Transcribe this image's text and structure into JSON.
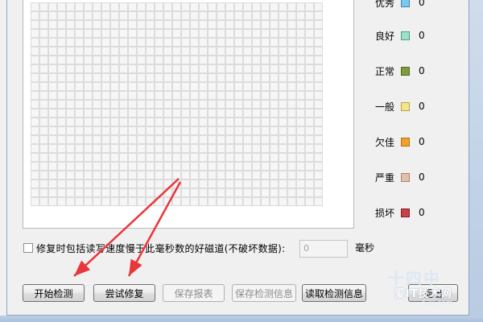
{
  "legend": {
    "items": [
      {
        "label": "优秀",
        "count": "0",
        "color": "#7cc8ee",
        "border": "#3c86b6"
      },
      {
        "label": "良好",
        "count": "0",
        "color": "#9ddfc8",
        "border": "#4d9e86"
      },
      {
        "label": "正常",
        "count": "0",
        "color": "#7e9b3e",
        "border": "#4d6a20"
      },
      {
        "label": "一般",
        "count": "0",
        "color": "#f5e58a",
        "border": "#b8a34a"
      },
      {
        "label": "欠佳",
        "count": "0",
        "color": "#f0a030",
        "border": "#b86e10"
      },
      {
        "label": "严重",
        "count": "0",
        "color": "#e2c0ac",
        "border": "#a8846e"
      },
      {
        "label": "损坏",
        "count": "0",
        "color": "#c8404a",
        "border": "#8a1e26"
      }
    ]
  },
  "options": {
    "repair_slow_label": "修复时包括读写速度慢于此毫秒数的好磁道(不破坏数据):",
    "threshold_value": "0",
    "threshold_unit": "毫秒"
  },
  "buttons": {
    "start_check": "开始检测",
    "try_repair": "尝试修复",
    "save_report": "保存报表",
    "save_check_info": "保存检测信息",
    "read_check_info": "读取检测信息",
    "exit": "退出"
  },
  "annotation": {
    "arrow_color": "#e8363b"
  },
  "watermark": {
    "line1": "十四中",
    "line2": "爱IT技术网",
    "line3": "52ij.com"
  }
}
